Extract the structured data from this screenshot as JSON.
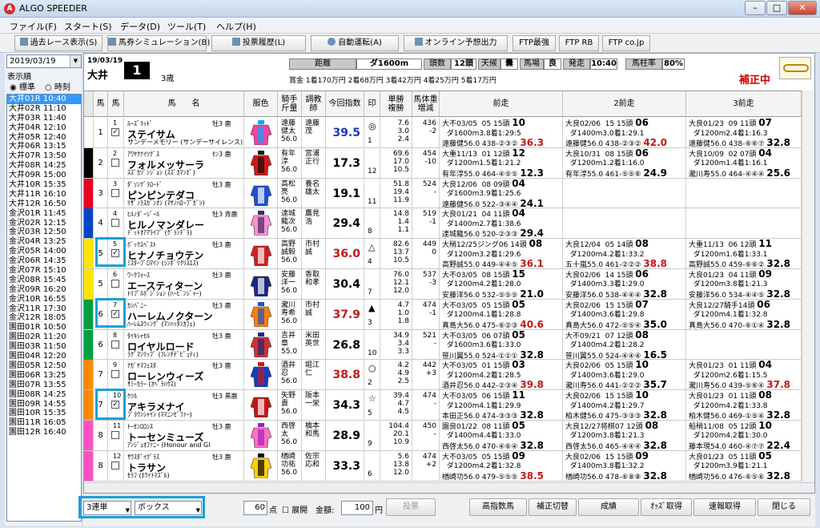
{
  "window": {
    "title": "ALGO SPEEDER",
    "icon": "A"
  },
  "menu": [
    "ファイル(F)",
    "スタート(S)",
    "データ(D)",
    "ツール(T)",
    "ヘルプ(H)"
  ],
  "toolbar": [
    {
      "label": "過去レース表示(S)",
      "icon": "search-icon"
    },
    {
      "label": "馬券シミュレーション(B)",
      "icon": "ticket-icon"
    },
    {
      "label": "投票履歴(L)",
      "icon": "history-icon"
    },
    {
      "label": "自動運転(A)",
      "icon": "clock-icon"
    },
    {
      "label": "オンライン予想出力",
      "icon": "online-icon"
    },
    {
      "label": "FTP最強",
      "icon": ""
    },
    {
      "label": "FTP RB",
      "icon": ""
    },
    {
      "label": "FTP co.jp",
      "icon": ""
    }
  ],
  "left": {
    "date": "2019/03/19",
    "sort_label": "表示順",
    "radio_std": "標準",
    "radio_time": "時刻",
    "races": [
      "大井01R 10:40",
      "大井02R 11:10",
      "大井03R 11:40",
      "大井04R 12:10",
      "大井05R 12:40",
      "大井06R 13:15",
      "大井07R 13:50",
      "大井08R 14:25",
      "大井09R 15:00",
      "大井10R 15:35",
      "大井11R 16:10",
      "大井12R 16:50",
      "金沢01R 11:45",
      "金沢02R 12:15",
      "金沢03R 12:50",
      "金沢04R 13:25",
      "金沢05R 14:00",
      "金沢06R 14:35",
      "金沢07R 15:10",
      "金沢08R 15:45",
      "金沢09R 16:20",
      "金沢10R 16:55",
      "金沢11R 17:30",
      "金沢12R 18:05",
      "園田01R 10:50",
      "園田02R 11:20",
      "園田03R 11:50",
      "園田04R 12:20",
      "園田05R 12:50",
      "園田06R 13:25",
      "園田07R 13:55",
      "園田08R 14:25",
      "園田09R 14:55",
      "園田10R 15:35",
      "園田11R 16:05",
      "園田12R 16:40"
    ]
  },
  "race": {
    "date": "19/03/19",
    "track": "大井",
    "num": "1",
    "age": "3歳",
    "dist_label": "距離",
    "dist": "ダ1600m",
    "heads_label": "頭数",
    "heads": "12頭",
    "weather_label": "天候",
    "weather": "曇",
    "baba_label": "馬場",
    "baba": "良",
    "start_label": "発走",
    "start": "10:40",
    "rate_label": "馬柱率",
    "rate": "80%",
    "prize": "賞金 1着170万円  2着68万円  3着42万円  4着25万円  5着17万円",
    "status": "補正中"
  },
  "columns": [
    "馬",
    "馬",
    "馬　　名",
    "服色",
    "騎手\n斤量",
    "調教\n師",
    "今回指数",
    "印",
    "単勝\n複勝",
    "馬体重\n増減",
    "前走",
    "2前走",
    "3前走"
  ],
  "horses": [
    {
      "waku": "1",
      "num": "1",
      "check": true,
      "small": "ﾙｰｽﾞﾘｯﾄﾞ",
      "sex": "牡3 鹿",
      "name": "ステイサム",
      "sire": "サンデーメモリー (サンデーサイレンス)",
      "jockey": "遠藤\n健太\n56.0",
      "trainer": "遠藤\n茂",
      "score": "39.5",
      "scoreColor": "#1a3cb0",
      "mark": "◎",
      "pop": "1",
      "odds": "7.6\n3.0\n2.4",
      "weight": "436\n-2",
      "p1": "大不03/05  05 15頭 10\n  ダ1600m3.8着1:29:5\n遠藤健56.0 438-②③② 36.3",
      "p1s": "36.3",
      "p2": "大良02/06  15 15頭 06\n  ダ1400m3.0着1:29.1\n遠藤健56.0 438-②③② 42.0",
      "p2s": "42.0",
      "p3": "大良01/23  09 11頭 07\n  ダ1200m2.4着1:16.3\n遠藤健56.0 438-⑥⑥⑦ 32.8",
      "p3s": "32.8"
    },
    {
      "waku": "2",
      "num": "2",
      "check": false,
      "small": "ｱﾜﾔｸﾅｲﾂｸﾞｽ",
      "sex": "ｾﾝ3 鹿",
      "name": "フォルメッサーラ",
      "sire": "ｽｽﾞｶｿﾞﾝｼﾞｮﾝ (ｽｽﾞｶﾏﾝﾎﾞ)",
      "jockey": "有年\n淳\n56.0",
      "trainer": "宮浦\n正行",
      "score": "17.3",
      "scoreColor": "#000",
      "mark": "",
      "pop": "12",
      "odds": "69.6\n17.0\n10.5",
      "weight": "454\n-10",
      "p1": "大重11/13  01 12頭 12\n  ダ1200m1.5着1:21.2\n有年淳55.0 464-④⑤⑤ 12.3",
      "p1s": "12.3",
      "p2": "大良10/31  08 15頭 06\n  ダ1200m1.2着1:16.0\n有年淳55.0 461-⑤⑤⑥ 24.9",
      "p2s": "24.9",
      "p3": "大良10/09  02 07頭 04\n  ダ1200m1.4着1:16.1\n瀧川寿55.0 464-④④④ 25.6",
      "p3s": "25.6"
    },
    {
      "waku": "3",
      "num": "3",
      "check": false,
      "small": "ﾀﾞｿﾝｸﾞﾗﾛｰﾄﾞ",
      "sex": "牡3 鹿",
      "name": "ピンピンテダコ",
      "sire": "ﾘｻﾞﾉﾗｽｶﾞﾝｵﾝ (ﾏｻﾉﾊﾛｰﾌﾟｶﾞﾝ)",
      "jockey": "高松\n亮\n56.0",
      "trainer": "養名\n雄太",
      "score": "19.1",
      "scoreColor": "#000",
      "mark": "",
      "pop": "11",
      "odds": "51.8\n19.4\n11.9",
      "weight": "524\n-",
      "p1": "大良12/06  08 09頭 04\n  ダ1600m3.9着1:25.6\n遠藤健56.0 522-③④④ 24.1",
      "p1s": "24.1",
      "p2": "",
      "p2s": "",
      "p3": "",
      "p3s": ""
    },
    {
      "waku": "4",
      "num": "4",
      "check": false,
      "small": "ﾋﾙﾉﾀﾞｰｼﾞｰﾙ",
      "sex": "牡3 斉鹿",
      "name": "ヒルノマンダレー",
      "sire": "ﾃﾞｯﾄｵｱｱﾗｲﾌﾞ (ｸﾞﾗﾝﾃﾞﾗ)",
      "jockey": "達城\n龍次\n56.0",
      "trainer": "鷹見\n浩",
      "score": "29.4",
      "scoreColor": "#000",
      "mark": "",
      "pop": "8",
      "odds": "14.8\n1.4\n1.1",
      "weight": "519\n-1",
      "p1": "大良01/21  04 11頭 04\n  ダ1400m2.7着1:38.6\n達城龍56.0 520-②③③ 29.4",
      "p1s": "29.4",
      "p2": "",
      "p2s": "",
      "p3": "",
      "p3s": ""
    },
    {
      "waku": "5",
      "num": "5",
      "check": true,
      "small": "ﾎﾞｯｸｽﾍﾞｽﾄ",
      "sex": "牡3 鹿",
      "name": "ヒナノチョウテン",
      "sire": "ﾐｽﾀｰﾌﾟﾛﾏｲﾝ (ｼﾝﾎﾞﾘｸﾘｽｴｽ)",
      "jockey": "高野\n誠毅\n56.0",
      "trainer": "市村\n誠",
      "score": "36.0",
      "scoreColor": "#c01818",
      "mark": "△",
      "pop": "4",
      "odds": "82.6\n13.7\n10.5",
      "weight": "449\n0",
      "p1": "大稍12/25ジング06 14頭 08\n  ダ1200m3.2着1:29.6\n高野誠55.0 449-④④⑤ 36.1",
      "p1s": "36.1",
      "p2": "大良12/04  05 14頭 08\n  ダ1200m4.2着1:33.2\n五十嵐55.0 461-②②② 38.8",
      "p2s": "38.8",
      "p3": "大重11/13  06 12頭 11\n  ダ1200m1.6着1:33.1\n高野誠55.0 459-⑥⑥② 32.8",
      "p3s": "32.8"
    },
    {
      "waku": "5",
      "num": "6",
      "check": false,
      "small": "ﾜｰｸﾌｫｰｽ",
      "sex": "牡3 鹿",
      "name": "エースティターン",
      "sire": "ﾄﾘﾌﾟﾙﾎﾞｼﾞｼｮﾝ (ﾊｰﾋﾞﾝｼﾞｬｰ)",
      "jockey": "安藤\n洋一\n56.0",
      "trainer": "香取\n和孝",
      "score": "30.4",
      "scoreColor": "#000",
      "mark": "",
      "pop": "7",
      "odds": "76.0\n12.1\n12.0",
      "weight": "537\n-3",
      "p1": "大不03/05  08 15頭 15\n  ダ1200m4.2着1:28.0\n安藤洋56.0 532-⑤⑤⑤ 21.0",
      "p1s": "21.0",
      "p2": "大良02/06  14 15頭 06\n  ダ1400m3.3着1:29.0\n安藤洋56.0 538-④④④ 32.8",
      "p2s": "32.8",
      "p3": "大良01/23  04 11頭 09\n  ダ1200m3.8着1:21.3\n安藤洋56.0 534-④④⑤ 32.8",
      "p3s": "32.8"
    },
    {
      "waku": "6",
      "num": "7",
      "check": true,
      "small": "ｶﾝﾊﾟﾆｰ",
      "sex": "牡3 鹿",
      "name": "ハーレムノクターン",
      "sire": "ﾊｰﾚﾑｽｳｨﾝｸﾞ (ﾏﾝﾊｯﾀﾝｶﾌｪ)",
      "jockey": "瀧川\n寿希\n56.0",
      "trainer": "市村\n誠",
      "score": "37.9",
      "scoreColor": "#c01818",
      "mark": "▲",
      "pop": "3",
      "odds": "4.7\n1.0\n1.8",
      "weight": "474\n-1",
      "p1": "大不03/05  05 15頭 05\n  ダ1200m4.1着1:28.8\n真島大56.0 475-⑥②③ 40.6",
      "p1s": "40.6",
      "p2": "大良02/06  15 15頭 07\n  ダ1400m3.6着1:29.8\n真島大56.0 472-⑤⑤④ 35.0",
      "p2s": "35.0",
      "p3": "大良12/27騎手14頭 06\n  ダ1200m4.1着1:32.8\n真島大56.0 470-⑥①④ 32.8",
      "p3s": "32.8"
    },
    {
      "waku": "6",
      "num": "8",
      "check": false,
      "small": "ﾀｲｷｼｬｾﾙ",
      "sex": "牡3 鹿",
      "name": "ロイヤルロード",
      "sire": "ﾗｸﾞﾏﾝﾘｯﾌﾟ (ﾌﾚﾝﾁﾃﾞﾋﾟｭﾃｨ)",
      "jockey": "吉井\n章\n55.0",
      "trainer": "米田\n英世",
      "score": "26.8",
      "scoreColor": "#000",
      "mark": "",
      "pop": "10",
      "odds": "34.9\n3.4\n3.3",
      "weight": "521\n-",
      "p1": "大不03/05  06 07頭 05\n  ダ1600m3.6着1:33.0\n笹川翼55.0 524-①①① 32.8",
      "p1s": "32.8",
      "p2": "大不09/21  07 12頭 08\n  ダ1400m4.2着1:28.2\n笹川翼55.0 524-④④④ 16.5",
      "p2s": "16.5",
      "p3": "",
      "p3s": ""
    },
    {
      "waku": "7",
      "num": "9",
      "check": false,
      "small": "ﾅｶﾞﾔﾏﾌｪｽﾀ",
      "sex": "牡3 鹿",
      "name": "ローレンウィーズ",
      "sire": "ｻﾐｰｶﾗｰ (ｵﾍﾟﾗﾊｳｽ)",
      "jockey": "酒井\n忍\n56.0",
      "trainer": "堀江\n仁",
      "score": "38.8",
      "scoreColor": "#c01818",
      "mark": "○",
      "pop": "2",
      "odds": "4.2\n4.9\n2.5",
      "weight": "442\n+3",
      "p1": "大不03/05  01 15頭 03\n  ダ1200m4.2着1:28.5\n酒井忍56.0 442-②③④ 39.8",
      "p1s": "39.8",
      "p2": "大良02/06  05 15頭 10\n  ダ1400m3.6着1:29.0\n瀧川寿56.0 441-②②② 35.7",
      "p2s": "35.7",
      "p3": "大良01/23  01 11頭 04\n  ダ1200m2.6着1:15.5\n瀧川寿56.0 439-⑤⑥④ 37.8",
      "p3s": "37.8"
    },
    {
      "waku": "7",
      "num": "10",
      "check": true,
      "small": "ｹﾂﾙ",
      "sex": "牡3 黒鹿",
      "name": "アキラメナイ",
      "sire": "ﾌﾞﾗｳﾝｼｬｲﾝ (ﾏﾏﾆﾝｾﾞﾌｧｰ)",
      "jockey": "矢野\n貴\n56.0",
      "trainer": "阪本\n一栄",
      "score": "34.3",
      "scoreColor": "#000",
      "mark": "☆",
      "pop": "5",
      "odds": "39.4\n4.7\n4.5",
      "weight": "474\n-",
      "p1": "大不03/05  06 15頭 11\n  ダ1200m4.1着1:29.9\n本田正56.0 474-③③③ 32.8",
      "p1s": "32.8",
      "p2": "大良02/06  15 15頭 10\n  ダ1400m4.2着1:29.7\n柏木健56.0 475-③③③ 32.8",
      "p2s": "32.8",
      "p3": "大良01/23  01 11頭 08\n  ダ1200m4.2着1:33.8\n柏木健56.0 469-①⑤④ 32.8",
      "p3s": "32.8"
    },
    {
      "waku": "8",
      "num": "11",
      "check": false,
      "small": "ﾄｰｾﾝﾛﾛｼｽ",
      "sex": "牡3 鹿",
      "name": "トーセンミューズ",
      "sire": "ｱﾝｼﾞｭｵﾌｧﾆｰ (Honour and Gl",
      "jockey": "西啓\n太\n56.0",
      "trainer": "橋本\n和馬",
      "score": "28.9",
      "scoreColor": "#000",
      "mark": "",
      "pop": "9",
      "odds": "104.4\n20.1\n10.9",
      "weight": "450\n-",
      "p1": "園良01/22  08 11頭 05\n  ダ1400m4.4着1:33.0\n西啓太56.0 470-④⑥④ 32.8",
      "p1s": "32.8",
      "p2": "大良12/27将棋07 12頭 08\n  ダ1200m3.8着1:21.3\n西啓太56.0 465-④④④ 32.8",
      "p2s": "32.8",
      "p3": "船稍11/08  05 12頭 10\n  ダ1200m4.2着1:30.0\n藤本現54.0 460-④⑦⑦ 22.4",
      "p3s": "22.4"
    },
    {
      "waku": "8",
      "num": "12",
      "check": false,
      "small": "ｻｳｽﾀﾞｲｸﾞﾗｽ",
      "sex": "牡3 鹿",
      "name": "トラサン",
      "sire": "ｾﾗﾌ (ﾎﾜｲﾄﾏｽﾞﾙ)",
      "jockey": "楢崎\n功祐\n56.0",
      "trainer": "佐宗\n応和",
      "score": "33.3",
      "scoreColor": "#000",
      "mark": "",
      "pop": "6",
      "odds": "5.6\n13.8\n12.0",
      "weight": "474\n+2",
      "p1": "大不03/05  05 15頭 09\n  ダ1200m4.2着1:32.8\n楢崎功56.0 479-⑤⑤⑤ 38.5",
      "p1s": "38.5",
      "p2": "大良02/06  15 15頭 09\n  ダ1400m3.8着1:32.2\n楢崎功56.0 478-⑥⑧⑧ 32.8",
      "p2s": "32.8",
      "p3": "大良01/23  05 11頭 05\n  ダ1200m3.9着1:21.1\n楢崎功56.0 476-⑥⑤⑥ 32.8",
      "p3s": "32.8"
    }
  ],
  "footer": {
    "bet_type": "3連単",
    "bet_mode": "ボックス",
    "points": "60",
    "points_unit": "点",
    "expand": "展開",
    "amount_label": "金額:",
    "amount": "100",
    "yen": "円",
    "vote": "投票",
    "buttons": [
      "高指数馬",
      "補正切替",
      "成績",
      "ｵｯｽﾞ取得",
      "速報取得",
      "閉じる"
    ]
  },
  "colors": {
    "waku": {
      "1": "#ffffff",
      "2": "#000000",
      "3": "#e8001c",
      "4": "#0047c8",
      "5": "#ffe600",
      "6": "#00a040",
      "7": "#ff8a00",
      "8": "#ff4fc0"
    },
    "status": "#d40000",
    "highlight": "#1aa0d8"
  }
}
